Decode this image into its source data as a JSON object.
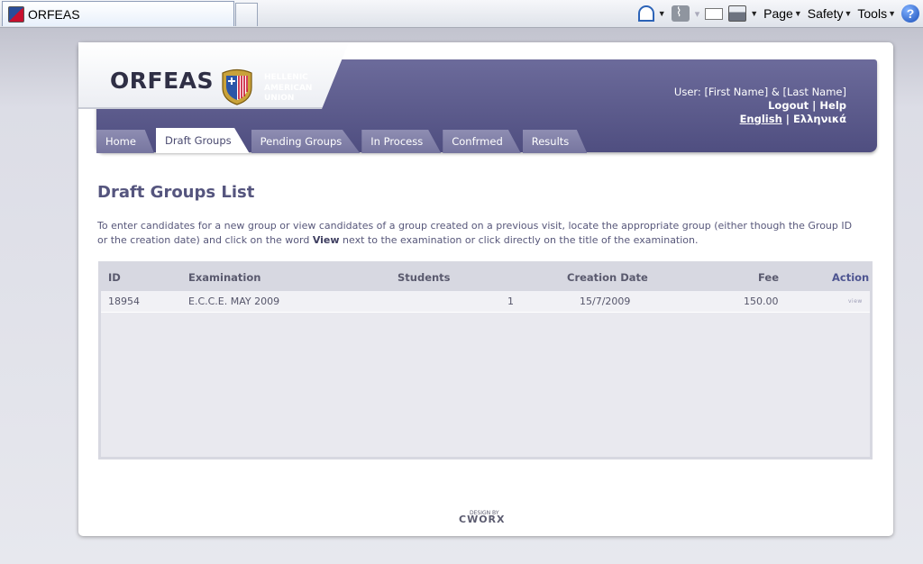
{
  "browser": {
    "tab_title": "ORFEAS",
    "menus": {
      "page": "Page",
      "safety": "Safety",
      "tools": "Tools"
    }
  },
  "header": {
    "logo": "ORFEAS",
    "org_lines": [
      "HELLENIC",
      "AMERICAN",
      "UNION"
    ],
    "user_text": "User: [First Name] & [Last Name]",
    "logout": "Logout",
    "separator": "|",
    "help": "Help",
    "lang_en": "English",
    "lang_gr": "Ελληνικά"
  },
  "tabs": [
    {
      "label": "Home",
      "active": false
    },
    {
      "label": "Draft Groups",
      "active": true
    },
    {
      "label": "Pending Groups",
      "active": false
    },
    {
      "label": "In Process",
      "active": false
    },
    {
      "label": "Confrmed",
      "active": false
    },
    {
      "label": "Results",
      "active": false
    }
  ],
  "main": {
    "title": "Draft Groups List",
    "intro_part1": "To enter candidates for a new group or view candidates of a group created on a previous visit, locate the appropriate group (either though the Group ID or the creation date) and click on the word ",
    "intro_bold": "View",
    "intro_part2": " next to the examination or click directly on the title of the examination."
  },
  "table": {
    "headers": {
      "id": "ID",
      "exam": "Examination",
      "students": "Students",
      "date": "Creation Date",
      "fee": "Fee",
      "action": "Action"
    },
    "rows": [
      {
        "id": "18954",
        "exam": "E.C.C.E. MAY 2009",
        "students": "1",
        "date": "15/7/2009",
        "fee": "150.00",
        "action": "view"
      }
    ]
  },
  "footer": {
    "design_by": "DESIGN BY",
    "brand": "CWORX"
  },
  "colors": {
    "header": "#5d5c8e",
    "tab": "#8584ab",
    "title": "#55557e",
    "grid": "#e9e9ef"
  }
}
